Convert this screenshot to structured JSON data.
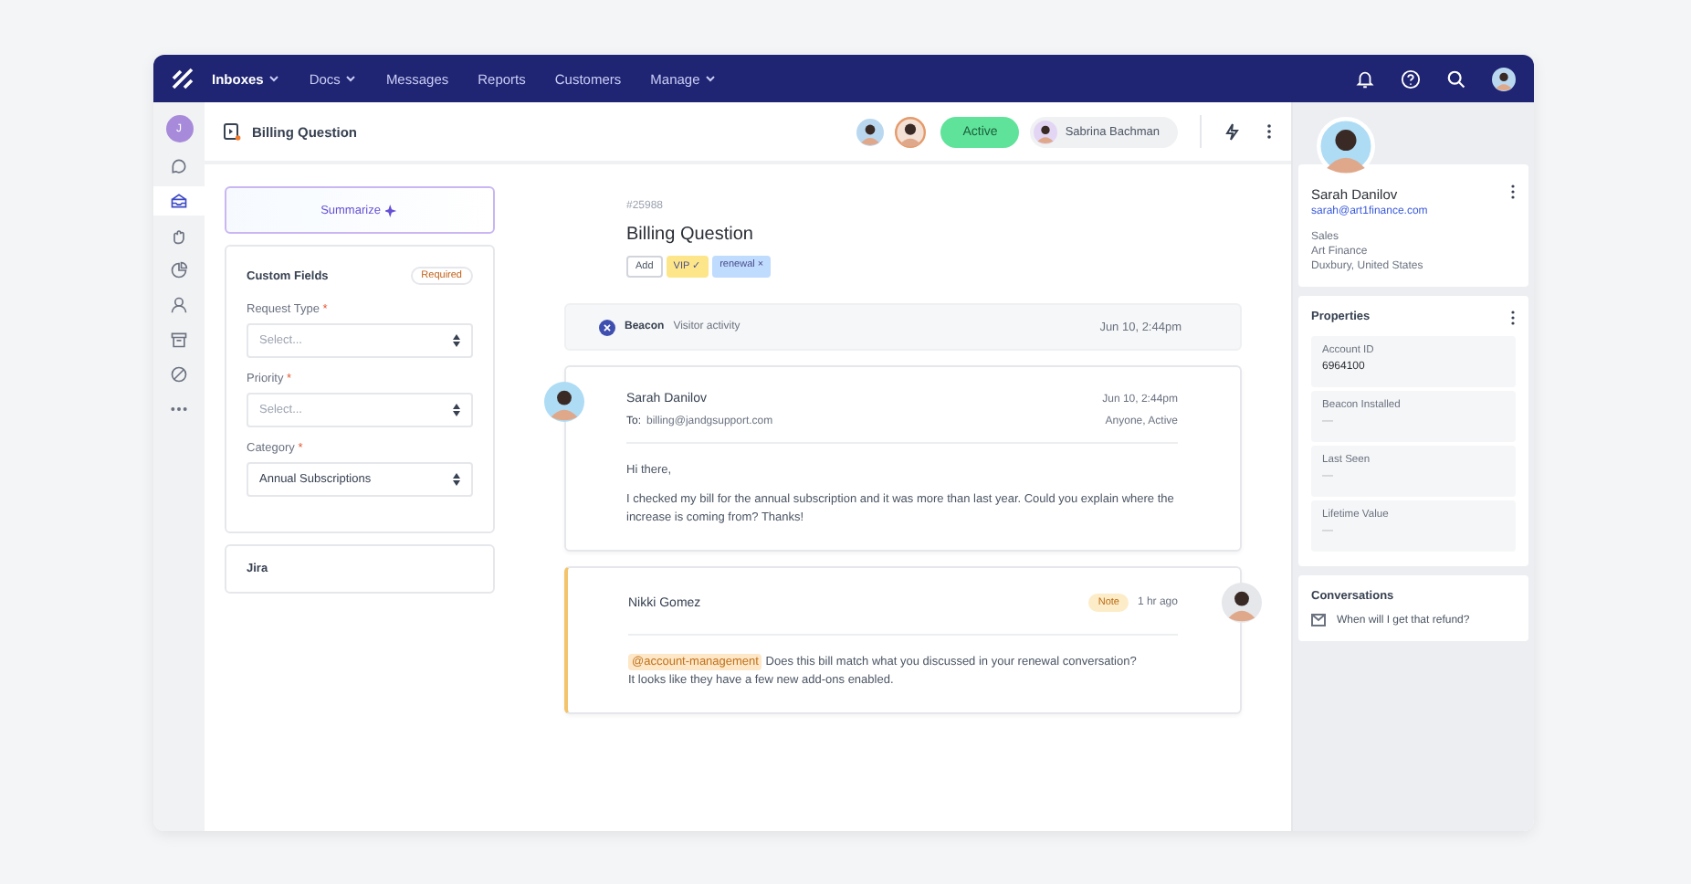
{
  "nav": {
    "items": [
      {
        "label": "Inboxes",
        "dropdown": true,
        "selected": true
      },
      {
        "label": "Docs",
        "dropdown": true,
        "selected": false
      },
      {
        "label": "Messages",
        "dropdown": false,
        "selected": false
      },
      {
        "label": "Reports",
        "dropdown": false,
        "selected": false
      },
      {
        "label": "Customers",
        "dropdown": false,
        "selected": false
      },
      {
        "label": "Manage",
        "dropdown": true,
        "selected": false
      }
    ]
  },
  "rail": {
    "avatar_initial": "J",
    "items": [
      {
        "kind": "chat",
        "selected": false
      },
      {
        "kind": "inbox",
        "selected": true
      },
      {
        "kind": "hand",
        "selected": false
      },
      {
        "kind": "chart",
        "selected": false
      },
      {
        "kind": "person",
        "selected": false
      },
      {
        "kind": "archive",
        "selected": false
      },
      {
        "kind": "blocked",
        "selected": false
      },
      {
        "kind": "more",
        "selected": false
      }
    ]
  },
  "ticket_header": {
    "title": "Billing Question",
    "status": "Active",
    "assignee": "Sabrina Bachman"
  },
  "summarize": "Summarize",
  "custom_fields": {
    "title": "Custom Fields",
    "badge": "Required",
    "fields": [
      {
        "label": "Request Type",
        "required_mark": "*",
        "placeholder": "Select..."
      },
      {
        "label": "Priority",
        "required_mark": "*",
        "placeholder": "Select..."
      },
      {
        "label": "Category",
        "required_mark": "*",
        "value": "Annual Subscriptions"
      }
    ]
  },
  "jira": "Jira",
  "conversation": {
    "number": "#25988",
    "title": "Billing Question",
    "add_label": "Add",
    "tags": [
      {
        "label": "VIP",
        "symbol": "✓",
        "color": "#fde68a"
      },
      {
        "label": "renewal",
        "symbol": "×",
        "color": "#bfdbfe"
      }
    ],
    "activity": {
      "source": "Beacon",
      "text": "Visitor activity",
      "time": "Jun 10, 2:44pm"
    },
    "messages": [
      {
        "kind": "email",
        "author": "Sarah Danilov",
        "to_label": "To:",
        "to": "billing@jandgsupport.com",
        "time": "Jun 10, 2:44pm",
        "audience": "Anyone, Active",
        "lines": [
          "Hi there,",
          "I checked my bill for the annual subscription and it was more than last year. Could you explain where the increase is coming from? Thanks!"
        ]
      },
      {
        "kind": "note",
        "author": "Nikki Gomez",
        "badge": "Note",
        "time": "1 hr ago",
        "mention": "@account-management",
        "lines": [
          "Does this bill match what you discussed in your renewal conversation?",
          "It looks like they have a few new add-ons enabled."
        ]
      }
    ]
  },
  "customer": {
    "name": "Sarah Danilov",
    "email": "sarah@art1finance.com",
    "details": [
      "Sales",
      "Art Finance",
      "Duxbury, United States"
    ]
  },
  "properties": {
    "title": "Properties",
    "items": [
      {
        "label": "Account ID",
        "value": "6964100"
      },
      {
        "label": "Beacon Installed",
        "value": "—"
      },
      {
        "label": "Last Seen",
        "value": "—"
      },
      {
        "label": "Lifetime Value",
        "value": "—"
      }
    ]
  },
  "conversations": {
    "title": "Conversations",
    "items": [
      "When will I get that refund?"
    ]
  }
}
